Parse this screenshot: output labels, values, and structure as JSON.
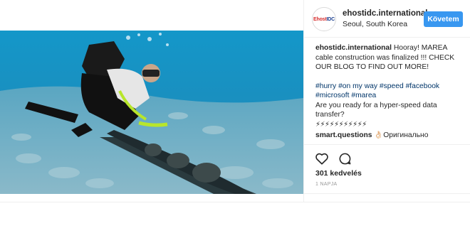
{
  "post": {
    "username": "ehostidc.international",
    "location": "Seoul, South Korea",
    "follow_label": "Követem",
    "avatar_logo": {
      "part1": "Ehost",
      "part2": "IDC"
    },
    "caption": {
      "user": "ehostidc.international",
      "text": " Hooray! MAREA cable construction was finalized !!! CHECK OUR BLOG TO FIND OUT MORE!",
      "hashtags_line1": [
        "#hurry",
        "#on my way",
        "#speed",
        "#facebook"
      ],
      "hashtags_line2": [
        "#microsoft",
        "#marea"
      ],
      "question": "Are you ready for a hyper-speed data transfer?",
      "emoji_row": "⚡⚡⚡⚡⚡⚡⚡⚡⚡⚡⚡"
    },
    "comment": {
      "user": "smart.questions",
      "text": " 👌🏻Оригинально"
    },
    "likes": "301 kedvelés",
    "timestamp": "1 NAPJA",
    "icons": {
      "like": "heart-icon",
      "comment": "comment-icon"
    }
  }
}
